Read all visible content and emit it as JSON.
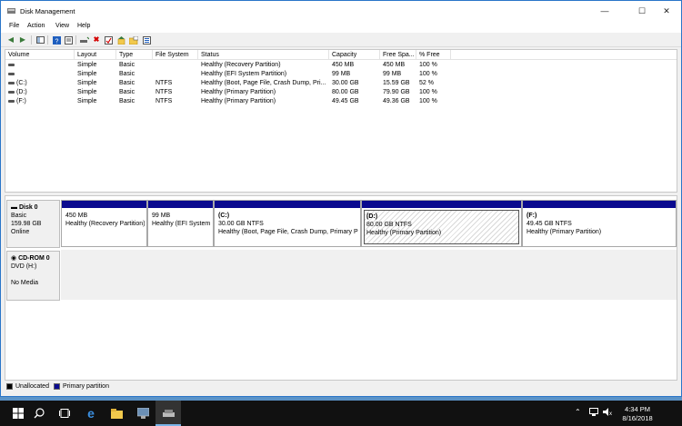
{
  "window": {
    "title": "Disk Management",
    "controls": {
      "minimize": "—",
      "maximize": "☐",
      "close": "✕"
    }
  },
  "menu": [
    "File",
    "Action",
    "View",
    "Help"
  ],
  "toolbar": {
    "icons": [
      "back-arrow-icon",
      "forward-arrow-icon",
      "console-tree-icon",
      "help-icon",
      "properties-icon",
      "connect-drive-icon",
      "delete-icon",
      "check-icon",
      "rescan-icon",
      "folder-icon",
      "settings-list-icon"
    ],
    "accent_colors": {
      "delete": "#d40000",
      "help": "#1f5fbf"
    }
  },
  "volume_list": {
    "columns": [
      "Volume",
      "Layout",
      "Type",
      "File System",
      "Status",
      "Capacity",
      "Free Spa...",
      "% Free"
    ],
    "rows": [
      {
        "volume": "",
        "layout": "Simple",
        "type": "Basic",
        "fs": "",
        "status": "Healthy (Recovery Partition)",
        "capacity": "450 MB",
        "free": "450 MB",
        "pct": "100 %"
      },
      {
        "volume": "",
        "layout": "Simple",
        "type": "Basic",
        "fs": "",
        "status": "Healthy (EFI System Partition)",
        "capacity": "99 MB",
        "free": "99 MB",
        "pct": "100 %"
      },
      {
        "volume": "(C:)",
        "layout": "Simple",
        "type": "Basic",
        "fs": "NTFS",
        "status": "Healthy (Boot, Page File, Crash Dump, Pri...",
        "capacity": "30.00 GB",
        "free": "15.59 GB",
        "pct": "52 %"
      },
      {
        "volume": "(D:)",
        "layout": "Simple",
        "type": "Basic",
        "fs": "NTFS",
        "status": "Healthy (Primary Partition)",
        "capacity": "80.00 GB",
        "free": "79.90 GB",
        "pct": "100 %"
      },
      {
        "volume": "(F:)",
        "layout": "Simple",
        "type": "Basic",
        "fs": "NTFS",
        "status": "Healthy (Primary Partition)",
        "capacity": "49.45 GB",
        "free": "49.36 GB",
        "pct": "100 %"
      }
    ]
  },
  "disks": [
    {
      "name": "Disk 0",
      "kind": "Basic",
      "size": "159.98 GB",
      "state": "Online",
      "partitions": [
        {
          "label": "",
          "size": "450 MB",
          "status": "Healthy (Recovery Partition)"
        },
        {
          "label": "",
          "size": "99 MB",
          "status": "Healthy (EFI System"
        },
        {
          "label": "(C:)",
          "size": "30.00 GB NTFS",
          "status": "Healthy (Boot, Page File, Crash Dump, Primary Pa"
        },
        {
          "label": "(D:)",
          "size": "80.00 GB NTFS",
          "status": "Healthy (Primary Partition)"
        },
        {
          "label": "(F:)",
          "size": "49.45 GB NTFS",
          "status": "Healthy (Primary Partition)"
        }
      ]
    }
  ],
  "cdrom": {
    "name": "CD-ROM 0",
    "drive": "DVD (H:)",
    "media": "No Media"
  },
  "legend": [
    {
      "label": "Unallocated",
      "color": "#000000"
    },
    {
      "label": "Primary partition",
      "color": "#0a0a8f"
    }
  ],
  "taskbar": {
    "icons": [
      "start-icon",
      "search-icon",
      "task-view-icon",
      "edge-icon",
      "file-explorer-icon",
      "server-manager-icon",
      "disk-management-icon"
    ],
    "tray_icons": [
      "chevron-up-icon",
      "network-icon",
      "volume-icon"
    ],
    "time": "4:34 PM",
    "date": "8/16/2018"
  }
}
